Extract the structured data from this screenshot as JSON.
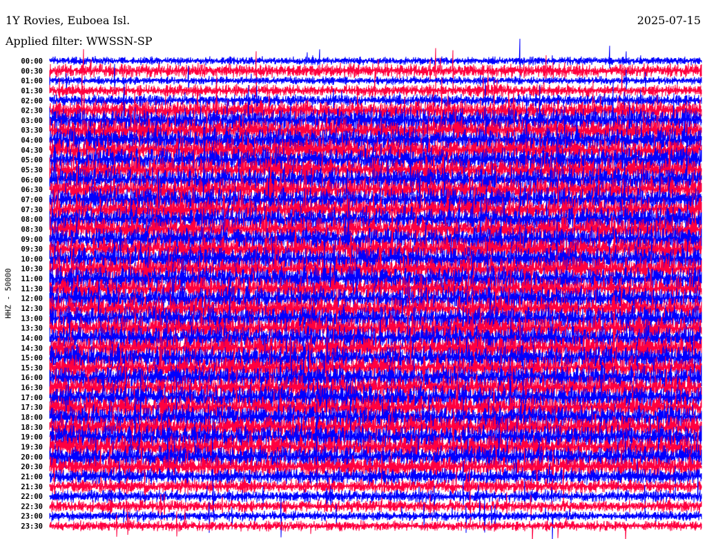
{
  "header": {
    "station": "1Y Rovies, Euboea Isl.",
    "date": "2025-07-15",
    "filter": "Applied filter: WWSSN-SP"
  },
  "chart_data": {
    "type": "line",
    "title": "1Y Rovies, Euboea Isl.",
    "ylabel": "HHZ - 50000",
    "xlabel": "",
    "row_interval_minutes": 30,
    "row_labels": [
      "00:00",
      "00:30",
      "01:00",
      "01:30",
      "02:00",
      "02:30",
      "03:00",
      "03:30",
      "04:00",
      "04:30",
      "05:00",
      "05:30",
      "06:00",
      "06:30",
      "07:00",
      "07:30",
      "08:00",
      "08:30",
      "09:00",
      "09:30",
      "10:00",
      "10:30",
      "11:00",
      "11:30",
      "12:00",
      "12:30",
      "13:00",
      "13:30",
      "14:00",
      "14:30",
      "15:00",
      "15:30",
      "16:00",
      "16:30",
      "17:00",
      "17:30",
      "18:00",
      "18:30",
      "19:00",
      "19:30",
      "20:00",
      "20:30",
      "21:00",
      "21:30",
      "22:00",
      "22:30",
      "23:00",
      "23:30"
    ],
    "series_colors": [
      "#0000ff",
      "#ff0040"
    ],
    "relative_amplitude": [
      0.2,
      0.5,
      0.2,
      0.4,
      0.4,
      0.8,
      1,
      1,
      1,
      1,
      1,
      1,
      1,
      1,
      1,
      1,
      1,
      1,
      1,
      1,
      1,
      1,
      1,
      1,
      1,
      1,
      1,
      1,
      1,
      1,
      1,
      1,
      1,
      1,
      1,
      1,
      1,
      1,
      1,
      1,
      0.9,
      0.8,
      0.6,
      0.5,
      0.4,
      0.4,
      0.3,
      0.3
    ]
  }
}
